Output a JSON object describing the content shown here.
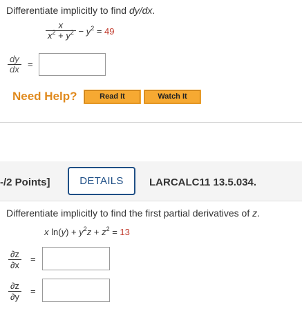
{
  "q1": {
    "prompt_text": "Differentiate implicitly to find ",
    "prompt_var": "dy/dx",
    "prompt_end": ".",
    "eq_num": "x",
    "eq_den_a": "x",
    "eq_den_exp1": "2",
    "eq_den_plus": " + ",
    "eq_den_b": "y",
    "eq_den_exp2": "2",
    "eq_minus": " − ",
    "eq_y": "y",
    "eq_exp": "2",
    "eq_equals": " = ",
    "eq_rhs": "49",
    "answer_num": "dy",
    "answer_den": "dx",
    "answer_eq": "=",
    "answer_value": ""
  },
  "help": {
    "label": "Need Help?",
    "read_it": "Read It",
    "watch_it": "Watch It"
  },
  "q2_header": {
    "points": "-/2 Points]",
    "details_button": "DETAILS",
    "problem_code": "LARCALC11 13.5.034."
  },
  "q2": {
    "prompt_text": "Differentiate implicitly to find the first partial derivatives of ",
    "prompt_var": "z",
    "prompt_end": ".",
    "eq_x": "x",
    "eq_ln": " ln(",
    "eq_y1": "y",
    "eq_close": ") + ",
    "eq_y2": "y",
    "eq_exp1": "2",
    "eq_z1": "z",
    "eq_plus": " + ",
    "eq_z2": "z",
    "eq_exp2": "2",
    "eq_equals": " = ",
    "eq_rhs": "13",
    "dzdx_num": "∂z",
    "dzdx_den": "∂x",
    "dzdy_num": "∂z",
    "dzdy_den": "∂y",
    "answer_eq": "=",
    "answer_dzdx": "",
    "answer_dzdy": ""
  },
  "colors": {
    "accent_orange": "#e08a1e",
    "button_orange": "#f6a932",
    "details_blue": "#1f4f86",
    "red_value": "#c0392b"
  }
}
